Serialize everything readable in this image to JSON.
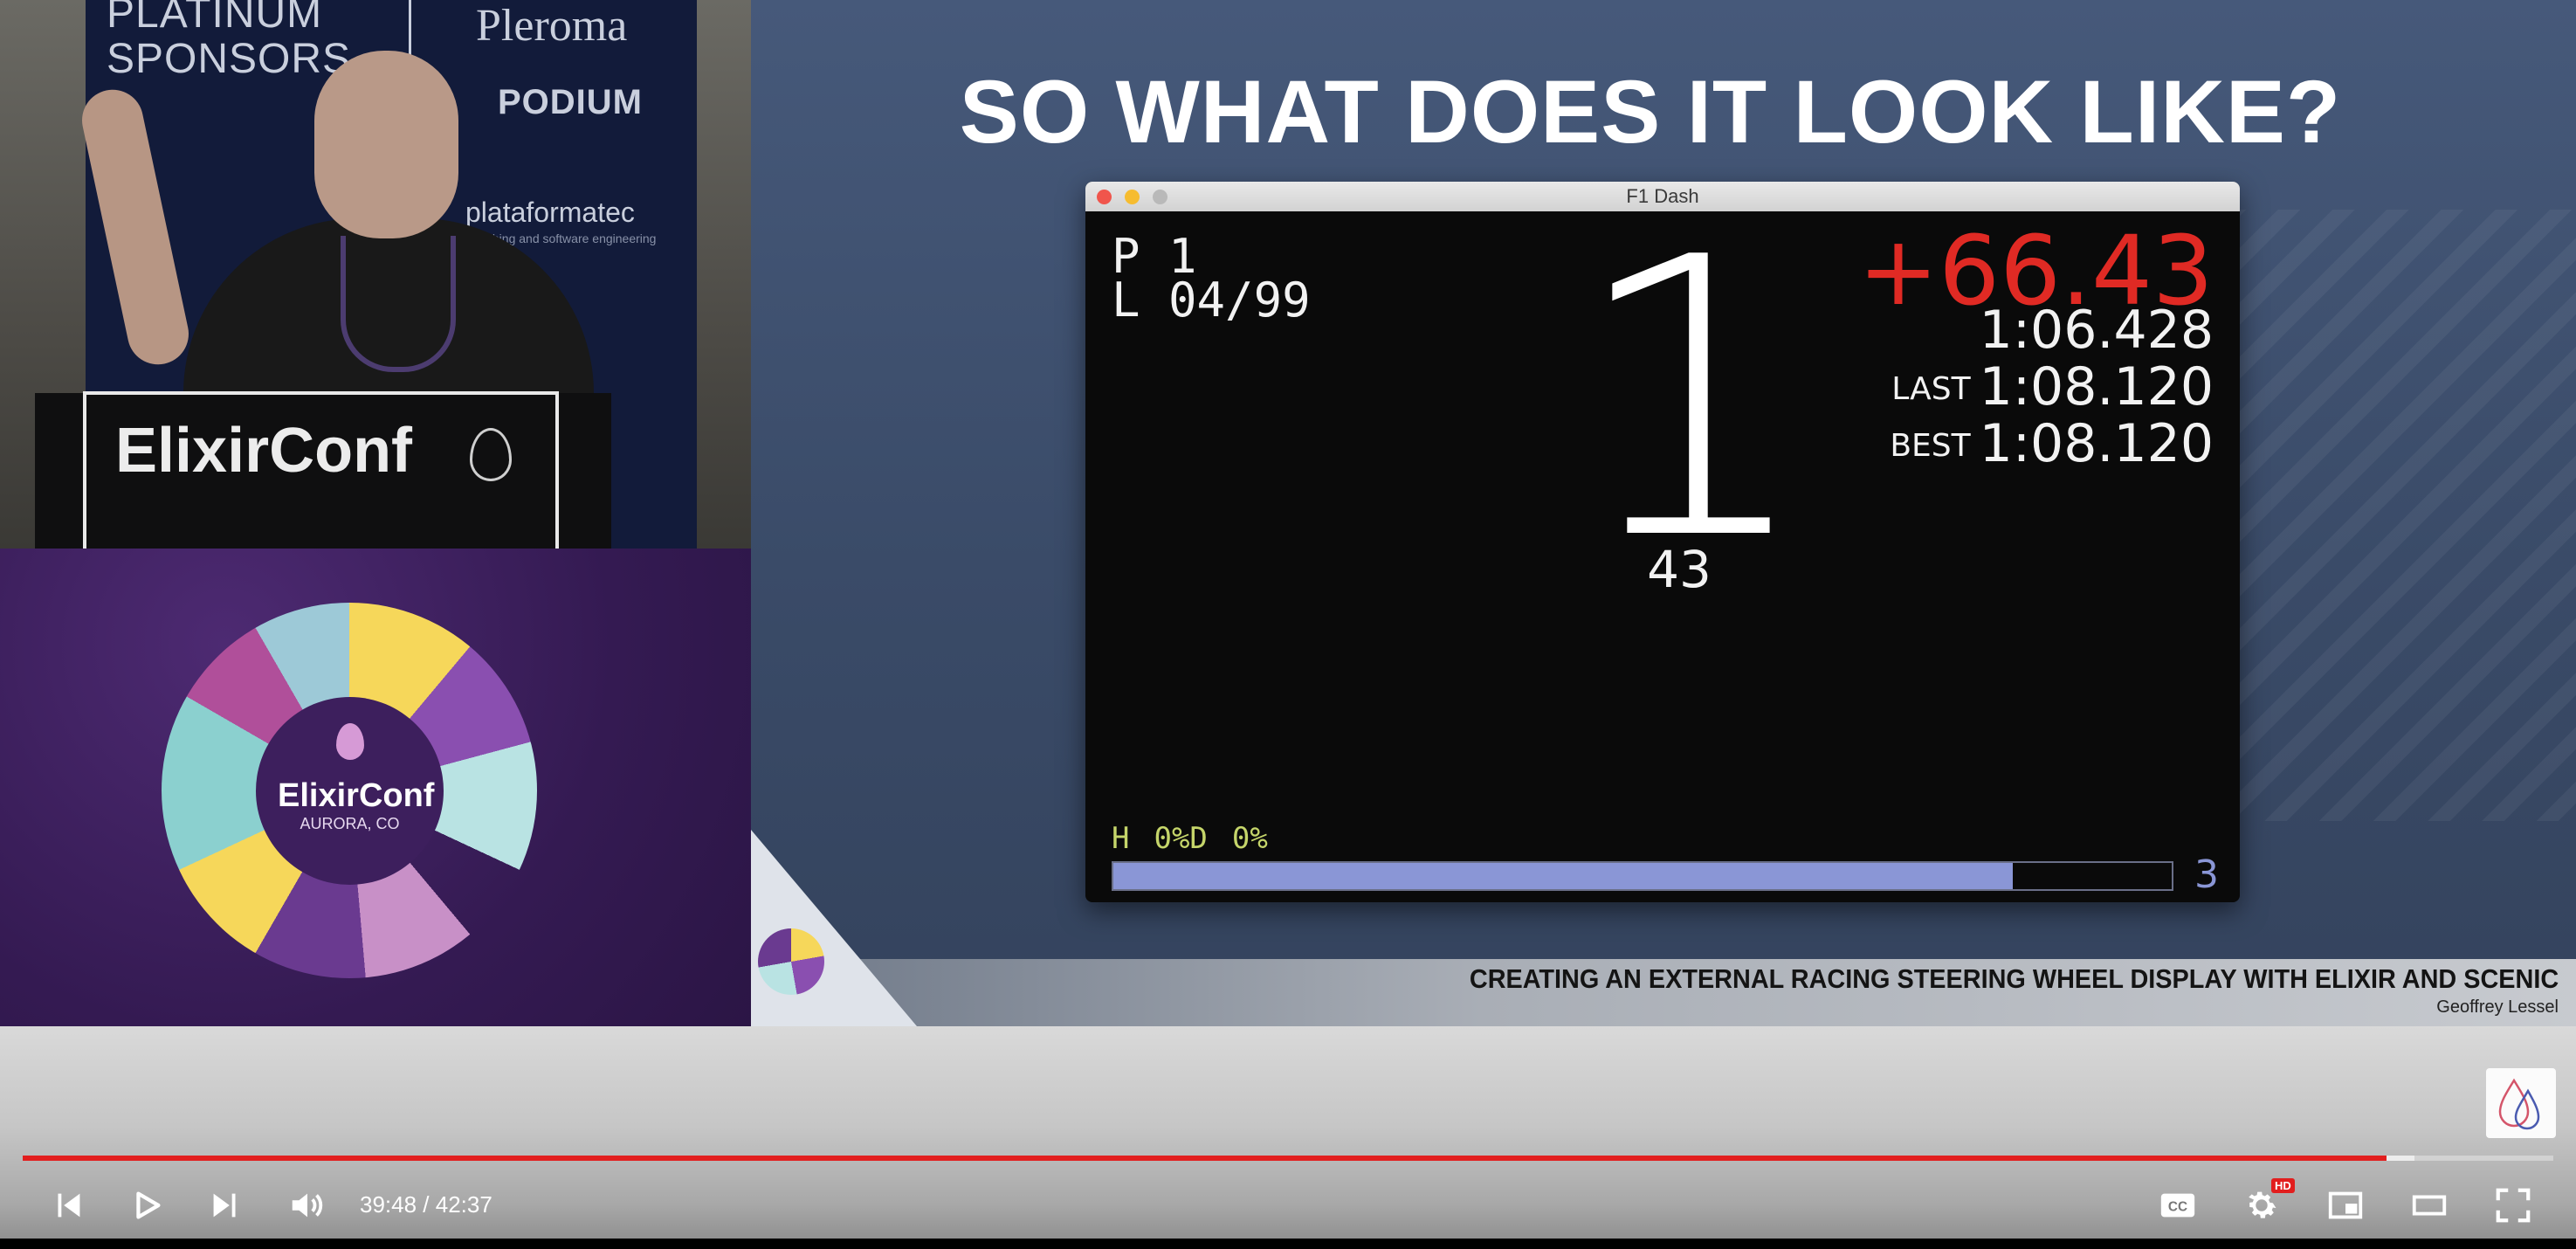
{
  "speaker_panel": {
    "sponsors_title": "PLATINUM\nSPONSORS",
    "sponsor_pleroma": "Pleroma",
    "sponsor_podium": "PODIUM",
    "sponsor_plataformatec": "plataformatec",
    "sponsor_plataformatec_tagline": "thing and software engineering",
    "podium_label": "ElixirConf"
  },
  "conf_logo": {
    "name": "ElixirConf",
    "location": "AURORA, CO"
  },
  "slide": {
    "title": "SO WHAT DOES IT LOOK LIKE?",
    "footer_title": "CREATING AN EXTERNAL RACING STEERING WHEEL DISPLAY WITH ELIXIR AND SCENIC",
    "footer_author": "Geoffrey Lessel"
  },
  "dash_window": {
    "title": "F1 Dash",
    "position_label": "P",
    "position": "1",
    "lap_label": "L",
    "lap": "04/99",
    "gear": "1",
    "speed": "43",
    "delta": "+66.43",
    "current_time": "1:06.428",
    "last_label": "LAST",
    "last_time": "1:08.120",
    "best_label": "BEST",
    "best_time": "1:08.120",
    "status_h": "H",
    "status_d": "0%D",
    "status_pct": "0%",
    "rpm_fraction": 0.85,
    "rpm_number": "3"
  },
  "player": {
    "current_time": "39:48",
    "separator": " / ",
    "duration": "42:37",
    "played_fraction": 0.934,
    "buffered_fraction": 0.945,
    "hd_badge": "HD",
    "accent_color": "#e21e1e"
  }
}
